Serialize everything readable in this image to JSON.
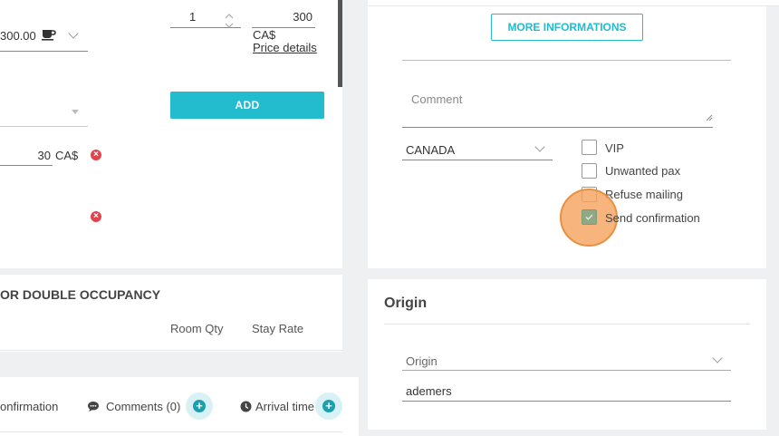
{
  "left_panel": {
    "price_select_value": "300.00",
    "qty_value": "1",
    "price_value": "300",
    "currency": "CA$",
    "price_details_link": "Price details",
    "add_button": "ADD",
    "line_amount": "30",
    "line_currency": "CA$"
  },
  "occupancy_section": {
    "title": "OR DOUBLE OCCUPANCY",
    "columns": [
      "Room Qty",
      "Stay Rate"
    ]
  },
  "bottom_tabs": {
    "confirmation": "onfirmation",
    "comments": "Comments (0)",
    "arrival_time": "Arrival time"
  },
  "right_panel": {
    "more_info_button": "MORE INFORMATIONS",
    "comment_placeholder": "Comment",
    "country_value": "CANADA",
    "checkboxes": [
      {
        "label": "VIP",
        "checked": false
      },
      {
        "label": "Unwanted pax",
        "checked": false
      },
      {
        "label": "Refuse mailing",
        "checked": false
      },
      {
        "label": "Send confirmation",
        "checked": true
      }
    ]
  },
  "origin_panel": {
    "title": "Origin",
    "origin_select_placeholder": "Origin",
    "origin_user_value": "ademers"
  },
  "colors": {
    "accent": "#22bcce",
    "error": "#e0454d",
    "highlight": "#f5a25d"
  }
}
